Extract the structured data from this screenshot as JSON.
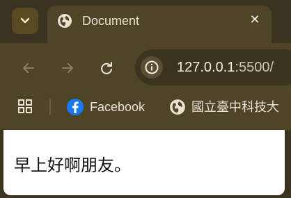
{
  "colors": {
    "browser_bg": "#3a3320",
    "toolbar_bg": "#4e4428",
    "omnibox_bg": "#3b3520",
    "text_light": "#f3efe3",
    "page_bg": "#ffffff"
  },
  "tab": {
    "title": "Document",
    "favicon": "globe-icon",
    "close_icon": "close-icon"
  },
  "tab_menu": {
    "icon": "chevron-down-icon"
  },
  "toolbar": {
    "back_icon": "arrow-left-icon",
    "forward_icon": "arrow-right-icon",
    "reload_icon": "reload-icon",
    "site_info_icon": "info-icon"
  },
  "address": {
    "host": "127.0.0.1",
    "rest": ":5500/"
  },
  "bookmarks": {
    "apps_icon": "apps-grid-icon",
    "items": [
      {
        "label": "Facebook",
        "icon": "facebook-icon"
      },
      {
        "label": "國立臺中科技大",
        "icon": "globe-icon"
      }
    ]
  },
  "page": {
    "text": "早上好啊朋友。"
  }
}
